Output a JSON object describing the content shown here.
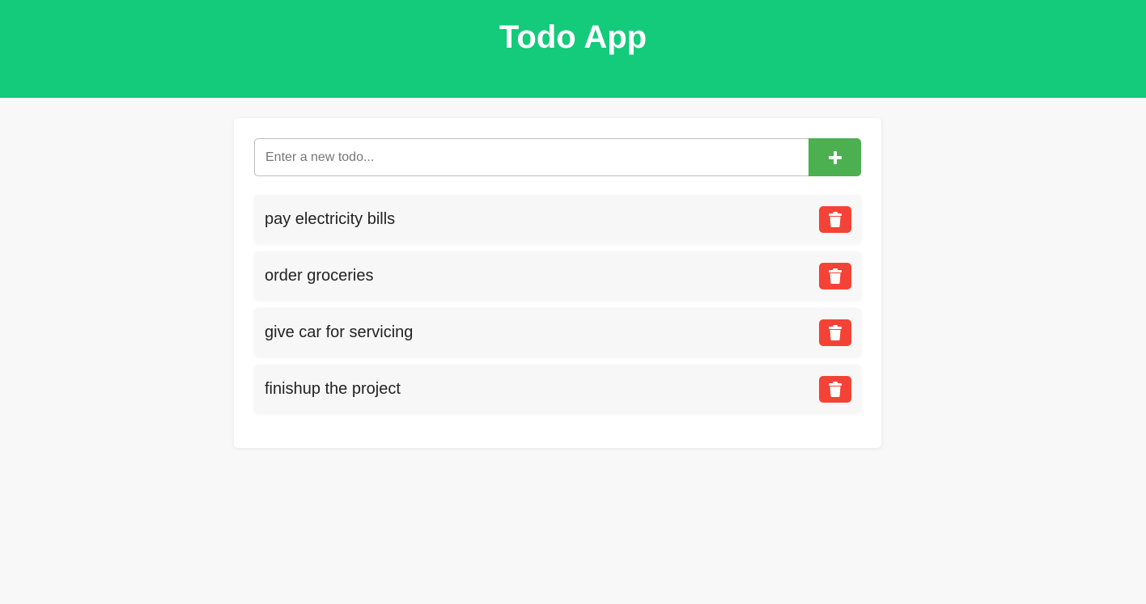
{
  "header": {
    "title": "Todo App"
  },
  "input": {
    "placeholder": "Enter a new todo...",
    "value": ""
  },
  "add_button": {
    "icon": "plus-icon"
  },
  "todos": [
    {
      "text": "pay electricity bills",
      "delete_icon": "trash-icon"
    },
    {
      "text": "order groceries",
      "delete_icon": "trash-icon"
    },
    {
      "text": "give car for servicing",
      "delete_icon": "trash-icon"
    },
    {
      "text": "finishup the project",
      "delete_icon": "trash-icon"
    }
  ],
  "colors": {
    "header_bg": "#13cb7b",
    "add_button": "#4caf50",
    "delete_button": "#f44336",
    "page_bg": "#f9f8f8"
  }
}
